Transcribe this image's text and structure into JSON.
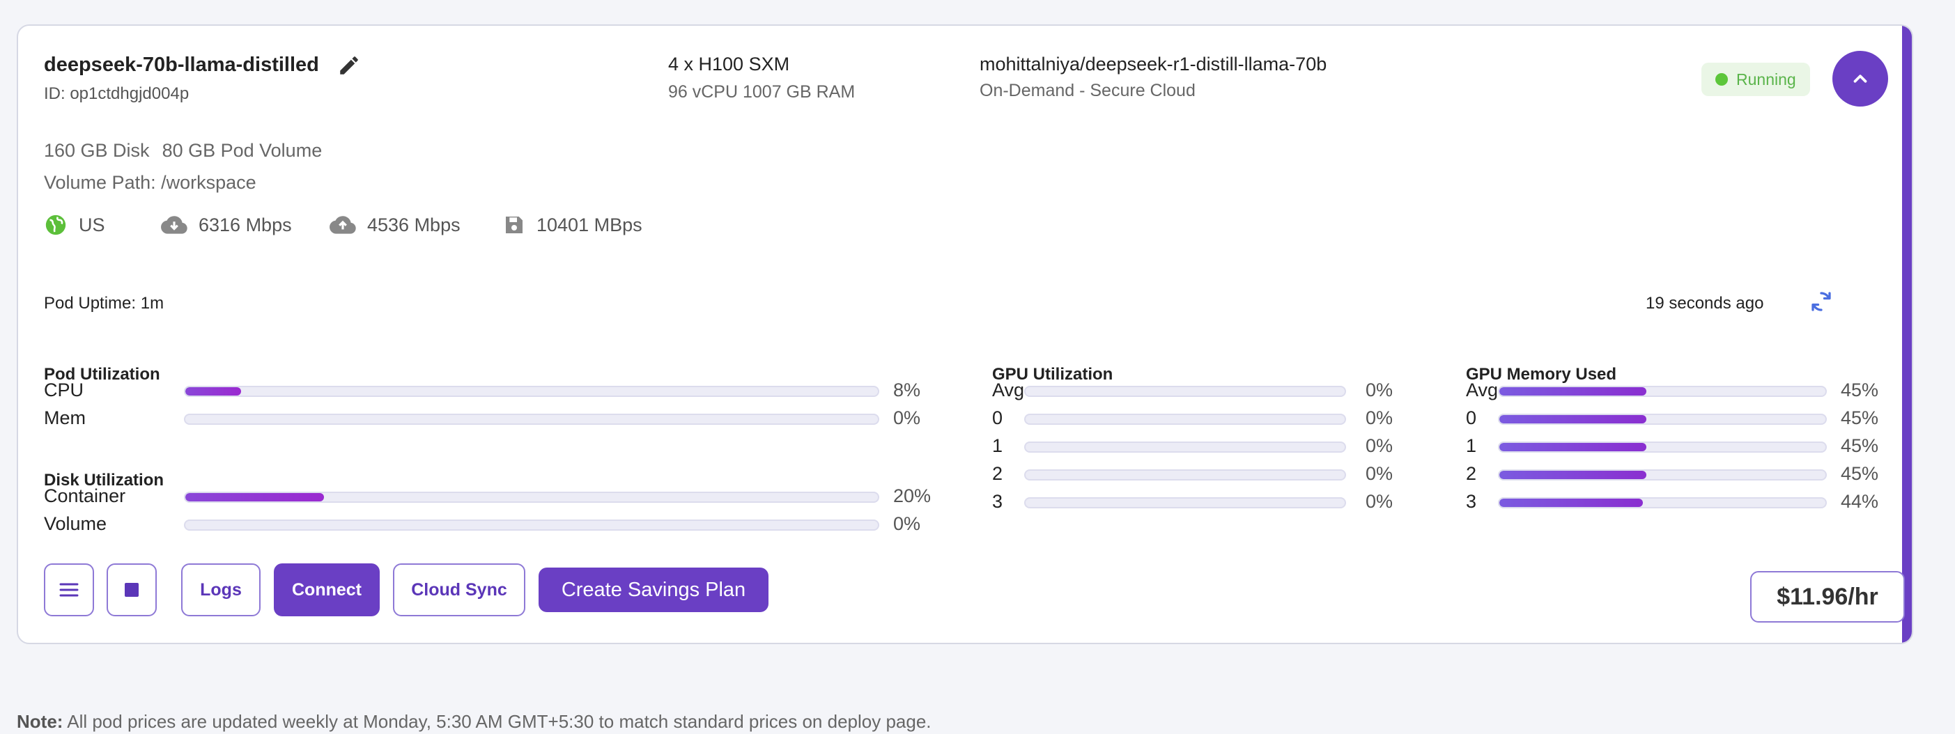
{
  "pod": {
    "name": "deepseek-70b-llama-distilled",
    "id_label": "ID: op1ctdhgjd004p",
    "gpu_type": "4 x H100 SXM",
    "gpu_spec": "96 vCPU 1007 GB RAM",
    "image": "mohittalniya/deepseek-r1-distill-llama-70b",
    "cloud_type": "On-Demand - Secure Cloud",
    "status": "Running",
    "disk": "160 GB Disk",
    "pod_volume": "80 GB Pod Volume",
    "volume_path": "Volume Path: /workspace",
    "region": "US",
    "download_speed": "6316 Mbps",
    "upload_speed": "4536 Mbps",
    "disk_speed": "10401 MBps",
    "uptime": "Pod Uptime: 1m",
    "last_updated": "19 seconds ago",
    "price": "$11.96/hr"
  },
  "colors": {
    "accent": "#6a3fc4",
    "status_green": "#5ab44a",
    "bar_fill": "#8a47d8"
  },
  "icons": {
    "edit": "pencil-icon",
    "collapse": "chevron-up-icon",
    "region": "globe-icon",
    "download": "cloud-download-icon",
    "upload": "cloud-upload-icon",
    "disk": "floppy-disk-icon",
    "refresh": "refresh-icon",
    "menu": "hamburger-menu-icon",
    "stop": "stop-icon"
  },
  "pod_utilization": {
    "title": "Pod Utilization",
    "rows": [
      {
        "label": "CPU",
        "percent": 8,
        "text": "8%"
      },
      {
        "label": "Mem",
        "percent": 0,
        "text": "0%"
      }
    ]
  },
  "disk_utilization": {
    "title": "Disk Utilization",
    "rows": [
      {
        "label": "Container",
        "percent": 20,
        "text": "20%"
      },
      {
        "label": "Volume",
        "percent": 0,
        "text": "0%"
      }
    ]
  },
  "gpu_utilization": {
    "title": "GPU Utilization",
    "rows": [
      {
        "label": "Avg",
        "percent": 0,
        "text": "0%"
      },
      {
        "label": "0",
        "percent": 0,
        "text": "0%"
      },
      {
        "label": "1",
        "percent": 0,
        "text": "0%"
      },
      {
        "label": "2",
        "percent": 0,
        "text": "0%"
      },
      {
        "label": "3",
        "percent": 0,
        "text": "0%"
      }
    ]
  },
  "gpu_memory": {
    "title": "GPU Memory Used",
    "rows": [
      {
        "label": "Avg",
        "percent": 45,
        "text": "45%"
      },
      {
        "label": "0",
        "percent": 45,
        "text": "45%"
      },
      {
        "label": "1",
        "percent": 45,
        "text": "45%"
      },
      {
        "label": "2",
        "percent": 45,
        "text": "45%"
      },
      {
        "label": "3",
        "percent": 44,
        "text": "44%"
      }
    ]
  },
  "buttons": {
    "logs": "Logs",
    "connect": "Connect",
    "cloud_sync": "Cloud Sync",
    "savings_plan": "Create Savings Plan"
  },
  "note": {
    "label": "Note:",
    "text": " All pod prices are updated weekly at Monday, 5:30 AM GMT+5:30 to match standard prices on deploy page."
  }
}
